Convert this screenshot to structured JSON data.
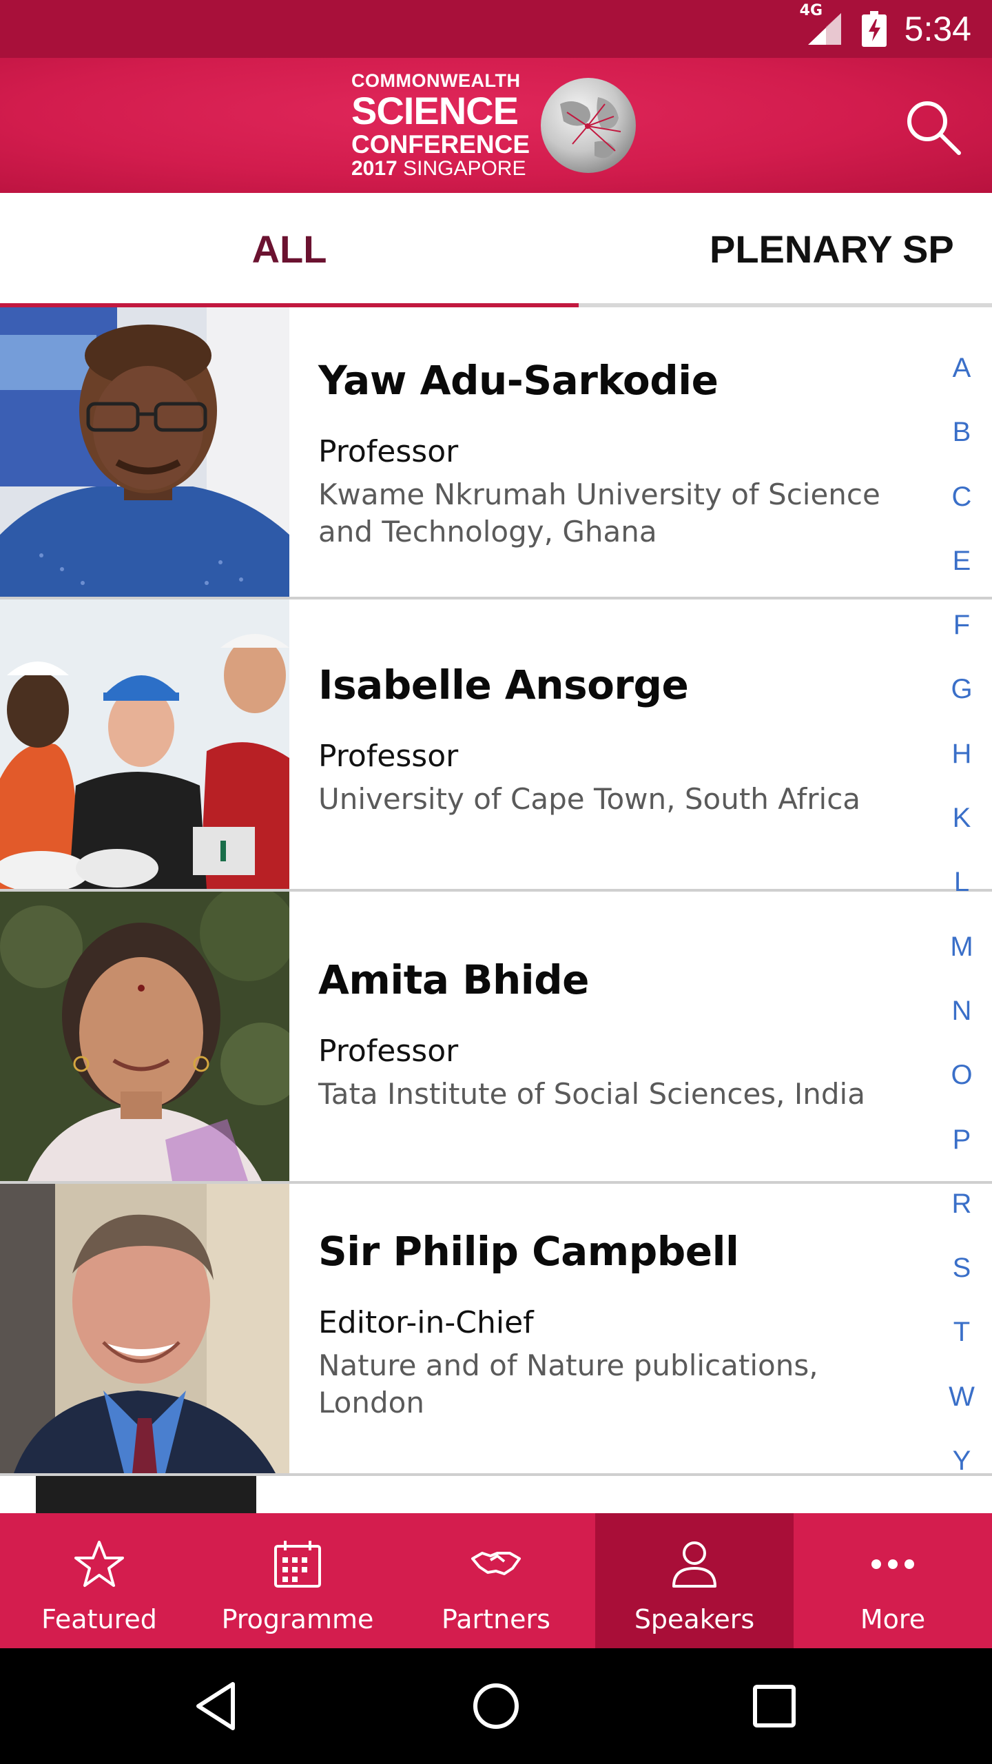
{
  "status_bar": {
    "network": "4G",
    "time": "5:34"
  },
  "header": {
    "logo": {
      "line1": "COMMONWEALTH",
      "line2": "SCIENCE",
      "line3": "CONFERENCE",
      "line4_year": "2017",
      "line4_place": "SINGAPORE"
    },
    "search_icon": "search-icon"
  },
  "tabs": [
    {
      "label": "ALL",
      "active": true
    },
    {
      "label": "PLENARY SP",
      "active": false
    }
  ],
  "speakers": [
    {
      "name": "Yaw Adu-Sarkodie",
      "title": "Professor",
      "organization": "Kwame Nkrumah University of Science and Technology, Ghana"
    },
    {
      "name": "Isabelle Ansorge",
      "title": "Professor",
      "organization": "University of Cape Town, South Africa"
    },
    {
      "name": "Amita Bhide",
      "title": "Professor",
      "organization": "Tata Institute of Social Sciences, India"
    },
    {
      "name": "Sir Philip Campbell",
      "title": "Editor-in-Chief",
      "organization": "Nature and of Nature publications, London"
    }
  ],
  "alphabet_index": [
    "A",
    "B",
    "C",
    "E",
    "F",
    "G",
    "H",
    "K",
    "L",
    "M",
    "N",
    "O",
    "P",
    "R",
    "S",
    "T",
    "W",
    "Y"
  ],
  "bottom_nav": [
    {
      "label": "Featured",
      "icon": "star-icon",
      "active": false
    },
    {
      "label": "Programme",
      "icon": "calendar-icon",
      "active": false
    },
    {
      "label": "Partners",
      "icon": "handshake-icon",
      "active": false
    },
    {
      "label": "Speakers",
      "icon": "person-icon",
      "active": true
    },
    {
      "label": "More",
      "icon": "more-icon",
      "active": false
    }
  ],
  "colors": {
    "brand": "#d41d4e",
    "brand_dark": "#a8103a",
    "tab_active_text": "#6b1230",
    "index_link": "#3a6fc8"
  }
}
